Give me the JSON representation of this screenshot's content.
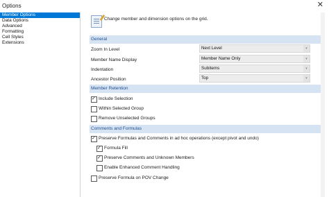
{
  "window": {
    "title": "Options",
    "close_glyph": "✕"
  },
  "sidebar": {
    "items": [
      {
        "label": "Member Options",
        "selected": true
      },
      {
        "label": "Data Options",
        "selected": false
      },
      {
        "label": "Advanced",
        "selected": false
      },
      {
        "label": "Formatting",
        "selected": false
      },
      {
        "label": "Cell Styles",
        "selected": false
      },
      {
        "label": "Extensions",
        "selected": false
      }
    ]
  },
  "header": {
    "description": "Change member and dimension options on the grid.",
    "icon": "edit-grid-icon"
  },
  "general": {
    "title": "General",
    "rows": [
      {
        "label": "Zoom In Level",
        "value": "Next Level"
      },
      {
        "label": "Member Name Display",
        "value": "Member Name Only"
      },
      {
        "label": "Indentation",
        "value": "Subitems"
      },
      {
        "label": "Ancestor Position",
        "value": "Top"
      }
    ]
  },
  "member_retention": {
    "title": "Member Retention",
    "options": [
      {
        "label": "Include Selection",
        "checked": true
      },
      {
        "label": "Within Selected Group",
        "checked": false
      },
      {
        "label": "Remove Unselected Groups",
        "checked": false
      }
    ]
  },
  "comments_formulas": {
    "title": "Comments and Formulas",
    "options": [
      {
        "label": "Preserve Formulas and Comments in ad hoc operations (except pivot and undo)",
        "checked": true
      },
      {
        "label": "Formula Fill",
        "checked": true
      },
      {
        "label": "Preserve Comments and Unknown Members",
        "checked": true
      },
      {
        "label": "Enable Enhanced Comment Handling",
        "checked": false
      },
      {
        "label": "Preserve Formula on POV Change",
        "checked": false
      }
    ]
  },
  "check_glyph": "✓",
  "dropdown_glyph": "▾",
  "colors": {
    "accent": "#0078d7",
    "section_bg": "#d6e3f3",
    "section_text": "#1f4e92"
  }
}
